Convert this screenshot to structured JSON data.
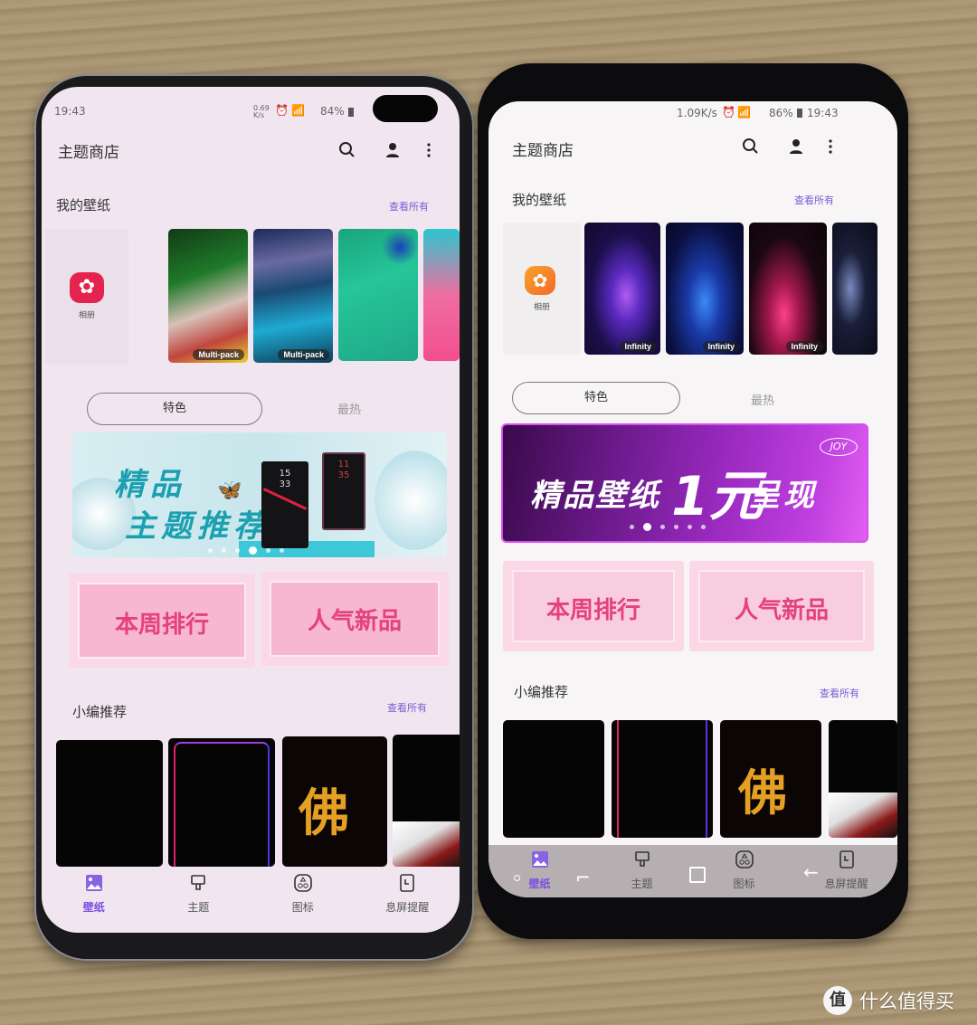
{
  "scene": "Two Samsung phones side by side on a wooden table showing the Theme Store app",
  "watermark": {
    "logo_char": "值",
    "text": "什么值得买"
  },
  "left_phone": {
    "status": {
      "time": "19:43",
      "speed": "0.69 K/s",
      "battery": "84%"
    },
    "header": {
      "title": "主题商店"
    },
    "my_wallpapers": {
      "title": "我的壁纸",
      "see_all": "查看所有",
      "album_label": "相册",
      "items": [
        {
          "tag": "Multi-pack"
        },
        {
          "tag": "Multi-pack"
        },
        {
          "tag": ""
        },
        {
          "tag": ""
        }
      ]
    },
    "tabs": [
      {
        "label": "特色",
        "active": true
      },
      {
        "label": "最热",
        "active": false
      }
    ],
    "banner": {
      "line1": "精品",
      "line2": "主题推荐",
      "phone1_time": "15\n33",
      "phone2_time": "11\n35",
      "slides": 6,
      "active_slide": 4
    },
    "cards": [
      {
        "label": "本周排行"
      },
      {
        "label": "人气新品"
      }
    ],
    "editor_picks": {
      "title": "小编推荐",
      "see_all": "查看所有"
    },
    "nav": [
      {
        "label": "壁纸",
        "active": true
      },
      {
        "label": "主题",
        "active": false
      },
      {
        "label": "图标",
        "active": false
      },
      {
        "label": "息屏提醒",
        "active": false
      }
    ]
  },
  "right_phone": {
    "status": {
      "time": "19:43",
      "speed": "1.09K/s",
      "battery": "86%"
    },
    "header": {
      "title": "主题商店"
    },
    "my_wallpapers": {
      "title": "我的壁纸",
      "see_all": "查看所有",
      "album_label": "相册",
      "items": [
        {
          "tag": "Infinity"
        },
        {
          "tag": "Infinity"
        },
        {
          "tag": "Infinity"
        },
        {
          "tag": ""
        }
      ]
    },
    "tabs": [
      {
        "label": "特色",
        "active": true
      },
      {
        "label": "最热",
        "active": false
      }
    ],
    "banner": {
      "text_a": "精品壁纸",
      "text_b": "1元",
      "text_c": "呈现",
      "badge": "JOY",
      "slides": 6,
      "active_slide": 2
    },
    "cards": [
      {
        "label": "本周排行"
      },
      {
        "label": "人气新品"
      }
    ],
    "editor_picks": {
      "title": "小编推荐",
      "see_all": "查看所有"
    },
    "nav": [
      {
        "label": "壁纸",
        "active": true
      },
      {
        "label": "主题",
        "active": false
      },
      {
        "label": "图标",
        "active": false
      },
      {
        "label": "息屏提醒",
        "active": false
      }
    ],
    "system_nav": [
      "recents",
      "home",
      "back"
    ]
  }
}
